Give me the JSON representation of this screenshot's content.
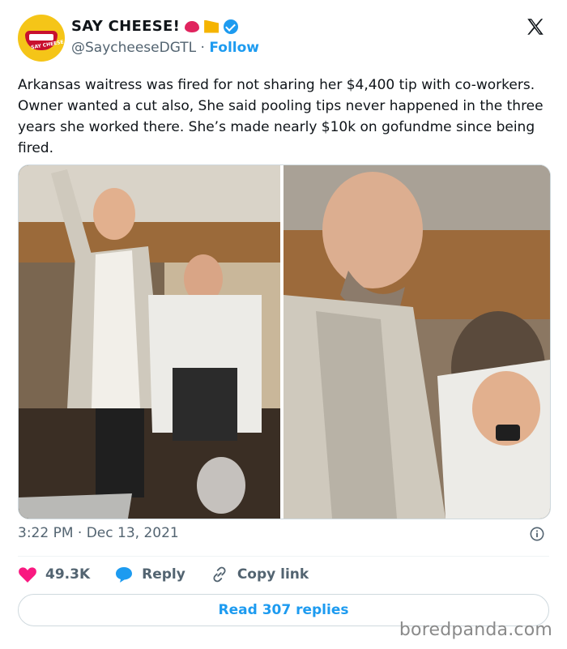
{
  "header": {
    "display_name": "SAY CHEESE!",
    "handle": "@SaycheeseDGTL",
    "separator": "·",
    "follow_label": "Follow",
    "avatar_text": "SAY CHEESE",
    "name_emojis": [
      "lips-icon",
      "cheese-icon"
    ],
    "verified_icon": "verified-badge-icon",
    "logo_icon": "x-logo-icon"
  },
  "tweet": {
    "text": "Arkansas waitress was fired for not sharing her $4,400 tip with co-workers. Owner wanted a cut also, She said pooling tips never happened in the three years she worked there. She’s made nearly $10k on gofundme since being fired."
  },
  "media": {
    "images": [
      "left-photo",
      "right-photo"
    ]
  },
  "meta": {
    "time": "3:22 PM",
    "date": "Dec 13, 2021",
    "separator": "·",
    "info_icon": "info-icon"
  },
  "actions": {
    "like_count": "49.3K",
    "reply_label": "Reply",
    "copy_label": "Copy link"
  },
  "read_replies_label": "Read 307 replies",
  "watermark": "boredpanda.com",
  "colors": {
    "accent": "#1d9bf0",
    "like": "#f91880",
    "text": "#0f1419",
    "muted": "#536471"
  }
}
